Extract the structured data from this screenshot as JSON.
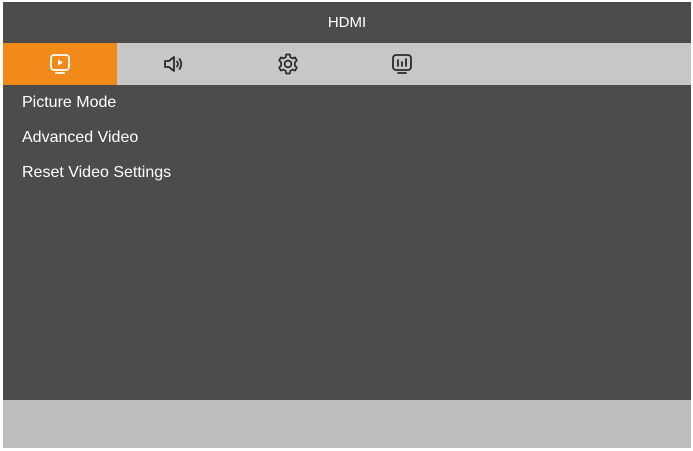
{
  "window": {
    "title": "HDMI"
  },
  "tabs": [
    {
      "icon": "picture-icon",
      "active": true
    },
    {
      "icon": "speaker-icon",
      "active": false
    },
    {
      "icon": "gear-icon",
      "active": false
    },
    {
      "icon": "display-info-icon",
      "active": false
    }
  ],
  "menu": {
    "items": [
      {
        "label": "Picture Mode"
      },
      {
        "label": "Advanced Video"
      },
      {
        "label": "Reset Video Settings"
      }
    ]
  },
  "colors": {
    "background": "#4d4c4c",
    "tab_bar": "#c7c7c7",
    "active_tab": "#f28a1a",
    "footer": "#bdbdbd",
    "text": "#ffffff"
  }
}
